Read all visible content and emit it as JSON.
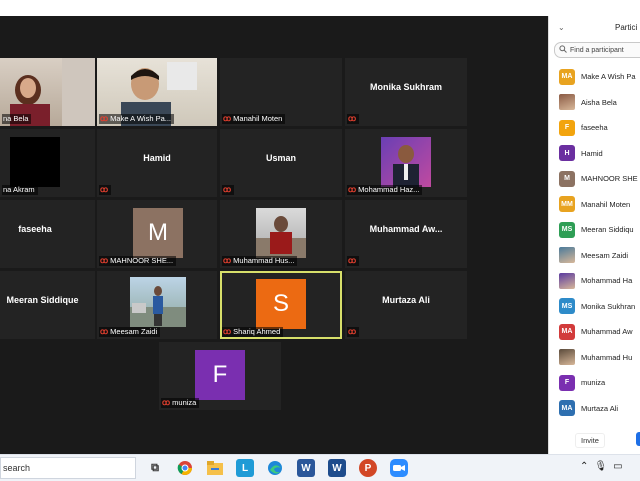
{
  "gallery": {
    "tiles": [
      {
        "label": "na Bela"
      },
      {
        "label": "Make A Wish Pa..."
      },
      {
        "label": "Manahil Moten"
      },
      {
        "name": "Monika Sukhram"
      },
      {
        "label": "na Akram"
      },
      {
        "name": "Hamid"
      },
      {
        "name": "Usman"
      },
      {
        "label": "Mohammad Haz..."
      },
      {
        "name": "faseeha"
      },
      {
        "label": "MAHNOOR SHE...",
        "initial": "M"
      },
      {
        "label": "Muhammad Hus..."
      },
      {
        "name": "Muhammad  Aw..."
      },
      {
        "name": "Meeran Siddique"
      },
      {
        "label": "Meesam Zaidi"
      },
      {
        "label": "Shariq Ahmed",
        "initial": "S"
      },
      {
        "name": "Murtaza Ali"
      },
      {
        "label": "muniza",
        "initial": "F"
      }
    ]
  },
  "sidebar": {
    "title": "Partici",
    "search_placeholder": "Find a participant",
    "participants": [
      {
        "initials": "MA",
        "name": "Make A Wish Pa",
        "color": "#e8a320"
      },
      {
        "initials": "",
        "name": "Aisha Bela",
        "color": "#8a5a44",
        "photo": true
      },
      {
        "initials": "F",
        "name": "faseeha",
        "color": "#f2a40e"
      },
      {
        "initials": "H",
        "name": "Hamid",
        "color": "#6b2fa0"
      },
      {
        "initials": "M",
        "name": "MAHNOOR SHE",
        "color": "#8c7262"
      },
      {
        "initials": "MM",
        "name": "Manahil Moten",
        "color": "#e8a320"
      },
      {
        "initials": "MS",
        "name": "Meeran Siddiqu",
        "color": "#2e9e55"
      },
      {
        "initials": "",
        "name": "Meesam Zaidi",
        "color": "#4a7a9a",
        "photo": true
      },
      {
        "initials": "",
        "name": "Mohammad Ha",
        "color": "#5a3aa0",
        "photo": true
      },
      {
        "initials": "MS",
        "name": "Monika Sukhran",
        "color": "#2e8bc9"
      },
      {
        "initials": "MA",
        "name": "Muhammad Aw",
        "color": "#d23b3b"
      },
      {
        "initials": "",
        "name": "Muhammad Hu",
        "color": "#5a4a3a",
        "photo": true
      },
      {
        "initials": "F",
        "name": "muniza",
        "color": "#7a2fb0"
      },
      {
        "initials": "MA",
        "name": "Murtaza Ali",
        "color": "#2e6fb0"
      }
    ],
    "invite_label": "Invite"
  },
  "taskbar": {
    "search_text": "search",
    "apps": [
      {
        "icon": "task-view-icon"
      },
      {
        "icon": "chrome-icon"
      },
      {
        "icon": "file-explorer-icon"
      },
      {
        "icon": "l-app-icon",
        "glyph": "L"
      },
      {
        "icon": "edge-icon"
      },
      {
        "icon": "word-icon",
        "glyph": "W"
      },
      {
        "icon": "word-icon-2",
        "glyph": "W"
      },
      {
        "icon": "powerpoint-icon",
        "glyph": "P"
      },
      {
        "icon": "zoom-icon"
      }
    ]
  },
  "colors": {
    "meeting_bg": "#1a1a1a",
    "tile_bg": "#232323",
    "active_border": "#d7df6a",
    "muted_icon": "#e5402f"
  }
}
